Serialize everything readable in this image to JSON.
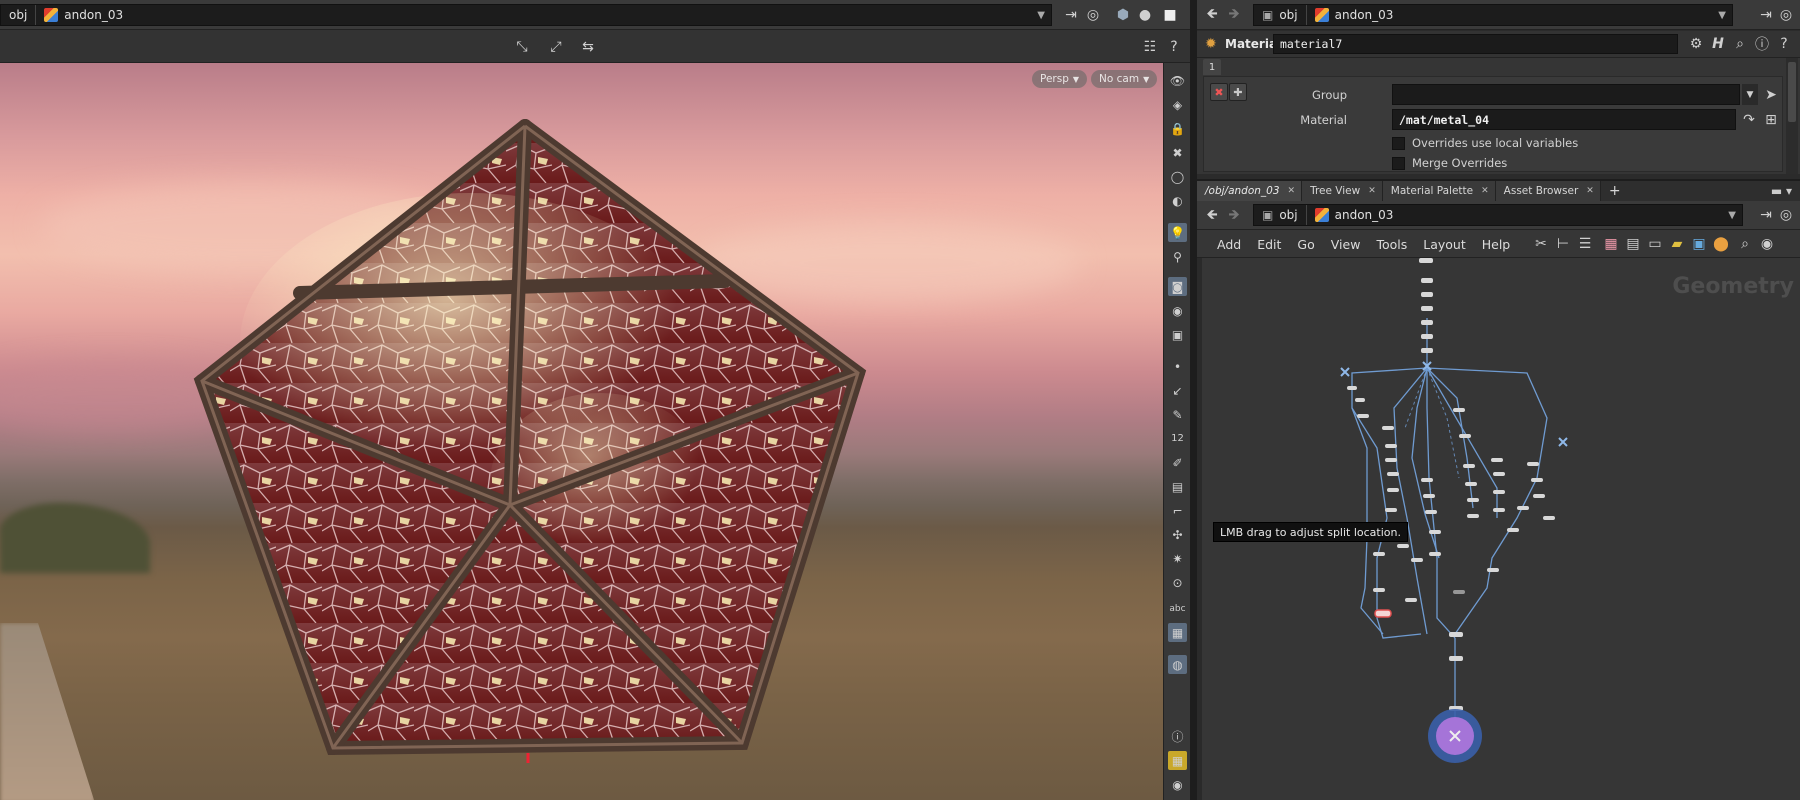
{
  "viewport": {
    "path_root": "obj",
    "path_node": "andon_03",
    "persp_label": "Persp",
    "cam_label": "No cam",
    "side_labels": {
      "digits": "12",
      "text_tool": "abc"
    }
  },
  "params": {
    "path_root": "obj",
    "path_node": "andon_03",
    "node_type": "Material",
    "node_name": "material7",
    "tab_number": "1",
    "group_label": "Group",
    "group_value": "",
    "material_label": "Material",
    "material_value": "/mat/metal_04",
    "overrides_label": "Overrides use local variables",
    "merge_label": "Merge Overrides"
  },
  "tabs": [
    {
      "label": "/obj/andon_03"
    },
    {
      "label": "Tree View"
    },
    {
      "label": "Material Palette"
    },
    {
      "label": "Asset Browser"
    }
  ],
  "network": {
    "path_root": "obj",
    "path_node": "andon_03",
    "menu": [
      "Add",
      "Edit",
      "Go",
      "View",
      "Tools",
      "Layout",
      "Help"
    ],
    "context_label": "Geometry",
    "tooltip": "LMB drag to adjust split location."
  },
  "colors": {
    "accent": "#5d6d80",
    "node_selected": "#7e6bd6",
    "wire": "#6f9bd1"
  }
}
